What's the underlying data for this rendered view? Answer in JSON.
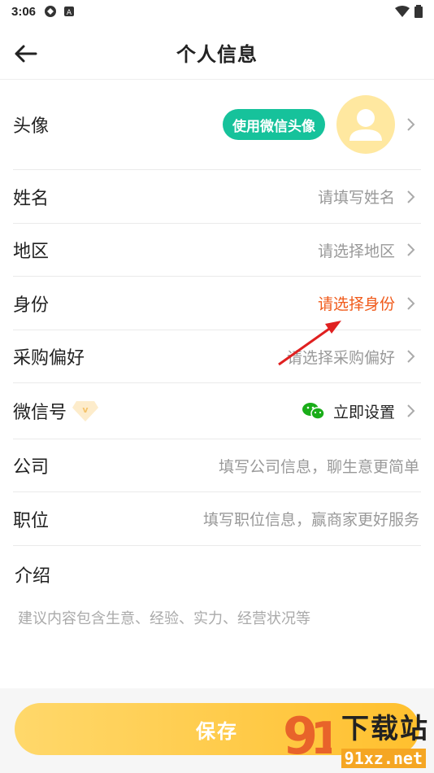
{
  "status_bar": {
    "time": "3:06"
  },
  "header": {
    "title": "个人信息"
  },
  "rows": {
    "avatar": {
      "label": "头像",
      "button": "使用微信头像"
    },
    "name": {
      "label": "姓名",
      "placeholder": "请填写姓名"
    },
    "region": {
      "label": "地区",
      "placeholder": "请选择地区"
    },
    "identity": {
      "label": "身份",
      "placeholder": "请选择身份",
      "color": "#f05a1a"
    },
    "purchase": {
      "label": "采购偏好",
      "placeholder": "请选择采购偏好"
    },
    "wechat": {
      "label": "微信号",
      "value": "立即设置"
    },
    "company": {
      "label": "公司",
      "placeholder": "填写公司信息，聊生意更简单"
    },
    "position": {
      "label": "职位",
      "placeholder": "填写职位信息，赢商家更好服务"
    }
  },
  "intro": {
    "label": "介绍",
    "placeholder": "建议内容包含生意、经验、实力、经营状况等"
  },
  "save_button": {
    "label": "保存"
  },
  "watermark": {
    "text": "下载站",
    "url": "91xz.net"
  },
  "colors": {
    "accent": "#ffc02e",
    "wechat_green": "#16c29b",
    "identity_orange": "#f05a1a"
  }
}
